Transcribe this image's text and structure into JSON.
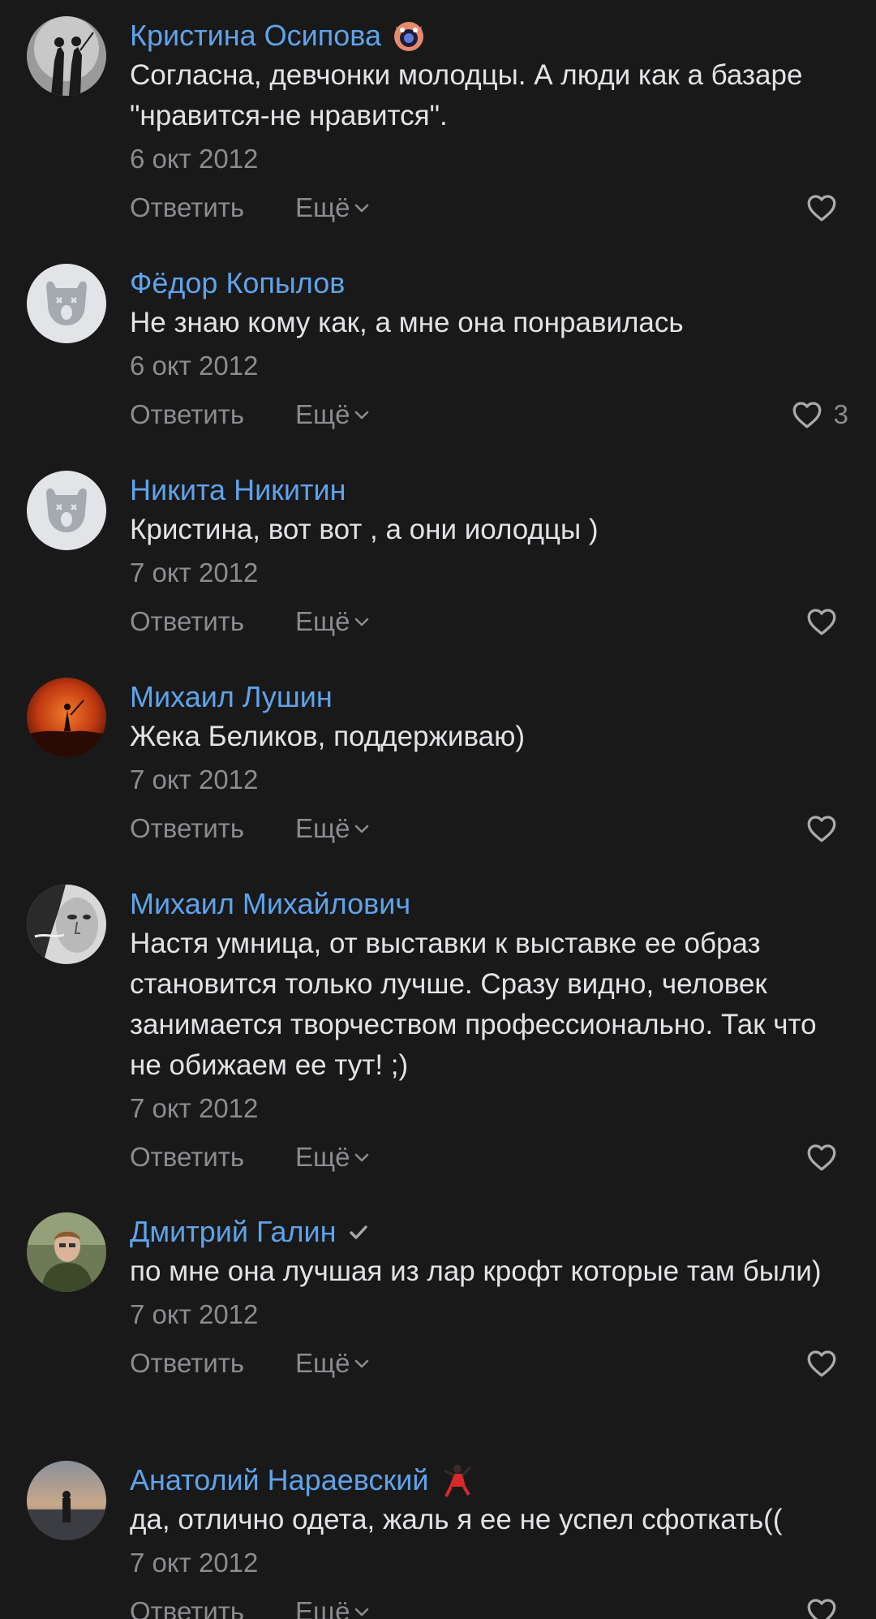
{
  "labels": {
    "reply": "Ответить",
    "more": "Ещё"
  },
  "comments": [
    {
      "author": "Кристина Осипова",
      "text": "Согласна, девчонки молодцы. А люди как а базаре \"нравится-не нравится\".",
      "date": "6 окт 2012",
      "likes": ""
    },
    {
      "author": "Фёдор Копылов",
      "text": "Не знаю кому как, а мне она понравилась",
      "date": "6 окт 2012",
      "likes": "3"
    },
    {
      "author": "Никита Никитин",
      "text": "Кристина, вот вот , а они иолодцы )",
      "date": "7 окт 2012",
      "likes": ""
    },
    {
      "author": "Михаил Лушин",
      "text": "Жека Беликов, поддерживаю)",
      "date": "7 окт 2012",
      "likes": ""
    },
    {
      "author": "Михаил Михайлович",
      "text": "Настя умница, от выставки к выставке ее образ становится только лучше. Сразу видно, человек занимается творчеством профессионально. Так что не обижаем ее тут! ;)",
      "date": "7 окт 2012",
      "likes": ""
    },
    {
      "author": "Дмитрий Галин",
      "text": "по мне она лучшая из лар крофт которые там были)",
      "date": "7 окт 2012",
      "likes": ""
    },
    {
      "author": "Анатолий Нараевский",
      "text": "да, отлично одета, жаль я ее не успел сфоткать((",
      "date": "7 окт 2012",
      "likes": ""
    }
  ],
  "colors": {
    "background": "#19191a",
    "author": "#5fa3ea",
    "text": "#e2e3e6",
    "secondary": "#8b8c90"
  }
}
